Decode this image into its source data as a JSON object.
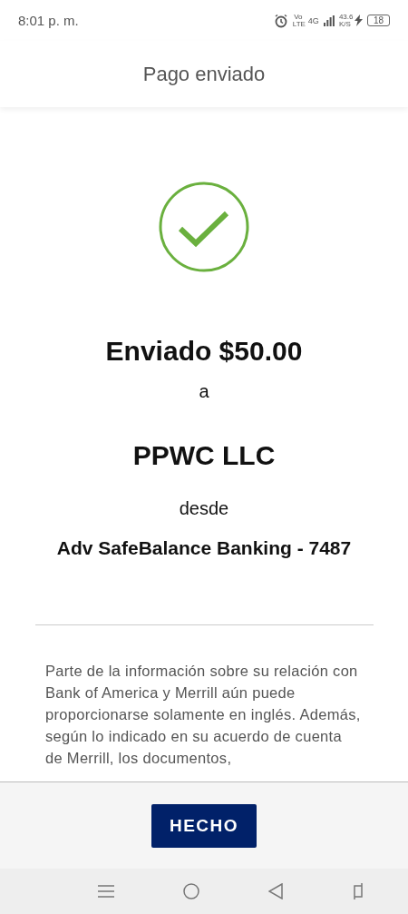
{
  "status_bar": {
    "time": "8:01 p. m.",
    "volte": "Vo LTE",
    "network": "4G",
    "speed": "43.6",
    "speed_unit": "K/S",
    "battery": "18"
  },
  "header": {
    "title": "Pago enviado"
  },
  "confirmation": {
    "amount_line": "Enviado $50.00",
    "to_label": "a",
    "payee": "PPWC LLC",
    "from_label": "desde",
    "account": "Adv SafeBalance Banking - 7487"
  },
  "disclaimer": "Parte de la información sobre su relación con Bank of America y Merrill aún puede proporcionarse solamente en inglés. Además, según lo indicado en su acuerdo de cuenta de Merrill, los documentos,",
  "footer": {
    "button": "HECHO"
  }
}
